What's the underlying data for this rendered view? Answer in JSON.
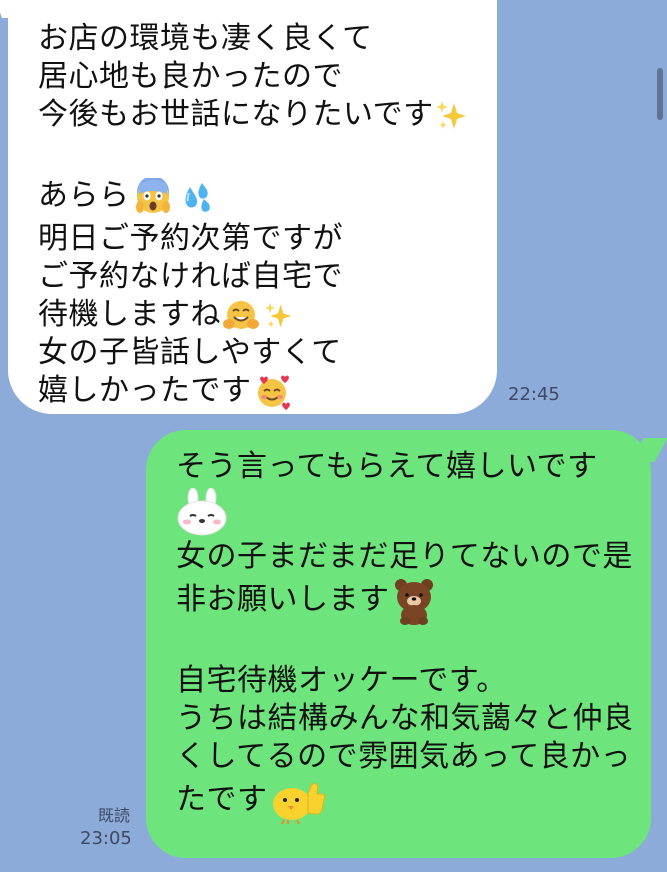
{
  "chat": {
    "received_message": {
      "lines_a": [
        "お店の環境も凄く良くて",
        "居心地も良かったので",
        "今後もお世話になりたいです"
      ],
      "lines_b": [
        "あらら",
        "明日ご予約次第ですが",
        "ご予約なければ自宅で",
        "待機しますね",
        "女の子皆話しやすくて",
        "嬉しかったです"
      ],
      "emojis": [
        "sparkles-icon",
        "face-screaming-icon",
        "sweat-droplets-icon",
        "hugging-face-icon",
        "smiling-face-hearts-icon"
      ],
      "time": "22:45"
    },
    "sent_message": {
      "lines": [
        "そう言ってもらえて嬉しいです",
        "女の子まだまだ足りてないので是",
        "非お願いします",
        "自宅待機オッケーです。",
        "うちは結構みんな和気藹々と仲良",
        "くしてるので雰囲気あって良かっ",
        "たです"
      ],
      "stickers": [
        "cony-rabbit-icon",
        "brown-bear-icon",
        "thumbs-up-chick-icon"
      ],
      "read_label": "既読",
      "time": "23:05"
    }
  },
  "colors": {
    "background": "#8CABD9",
    "received_bubble": "#FFFFFF",
    "sent_bubble": "#6DE57C",
    "timestamp": "#3E4A63"
  }
}
